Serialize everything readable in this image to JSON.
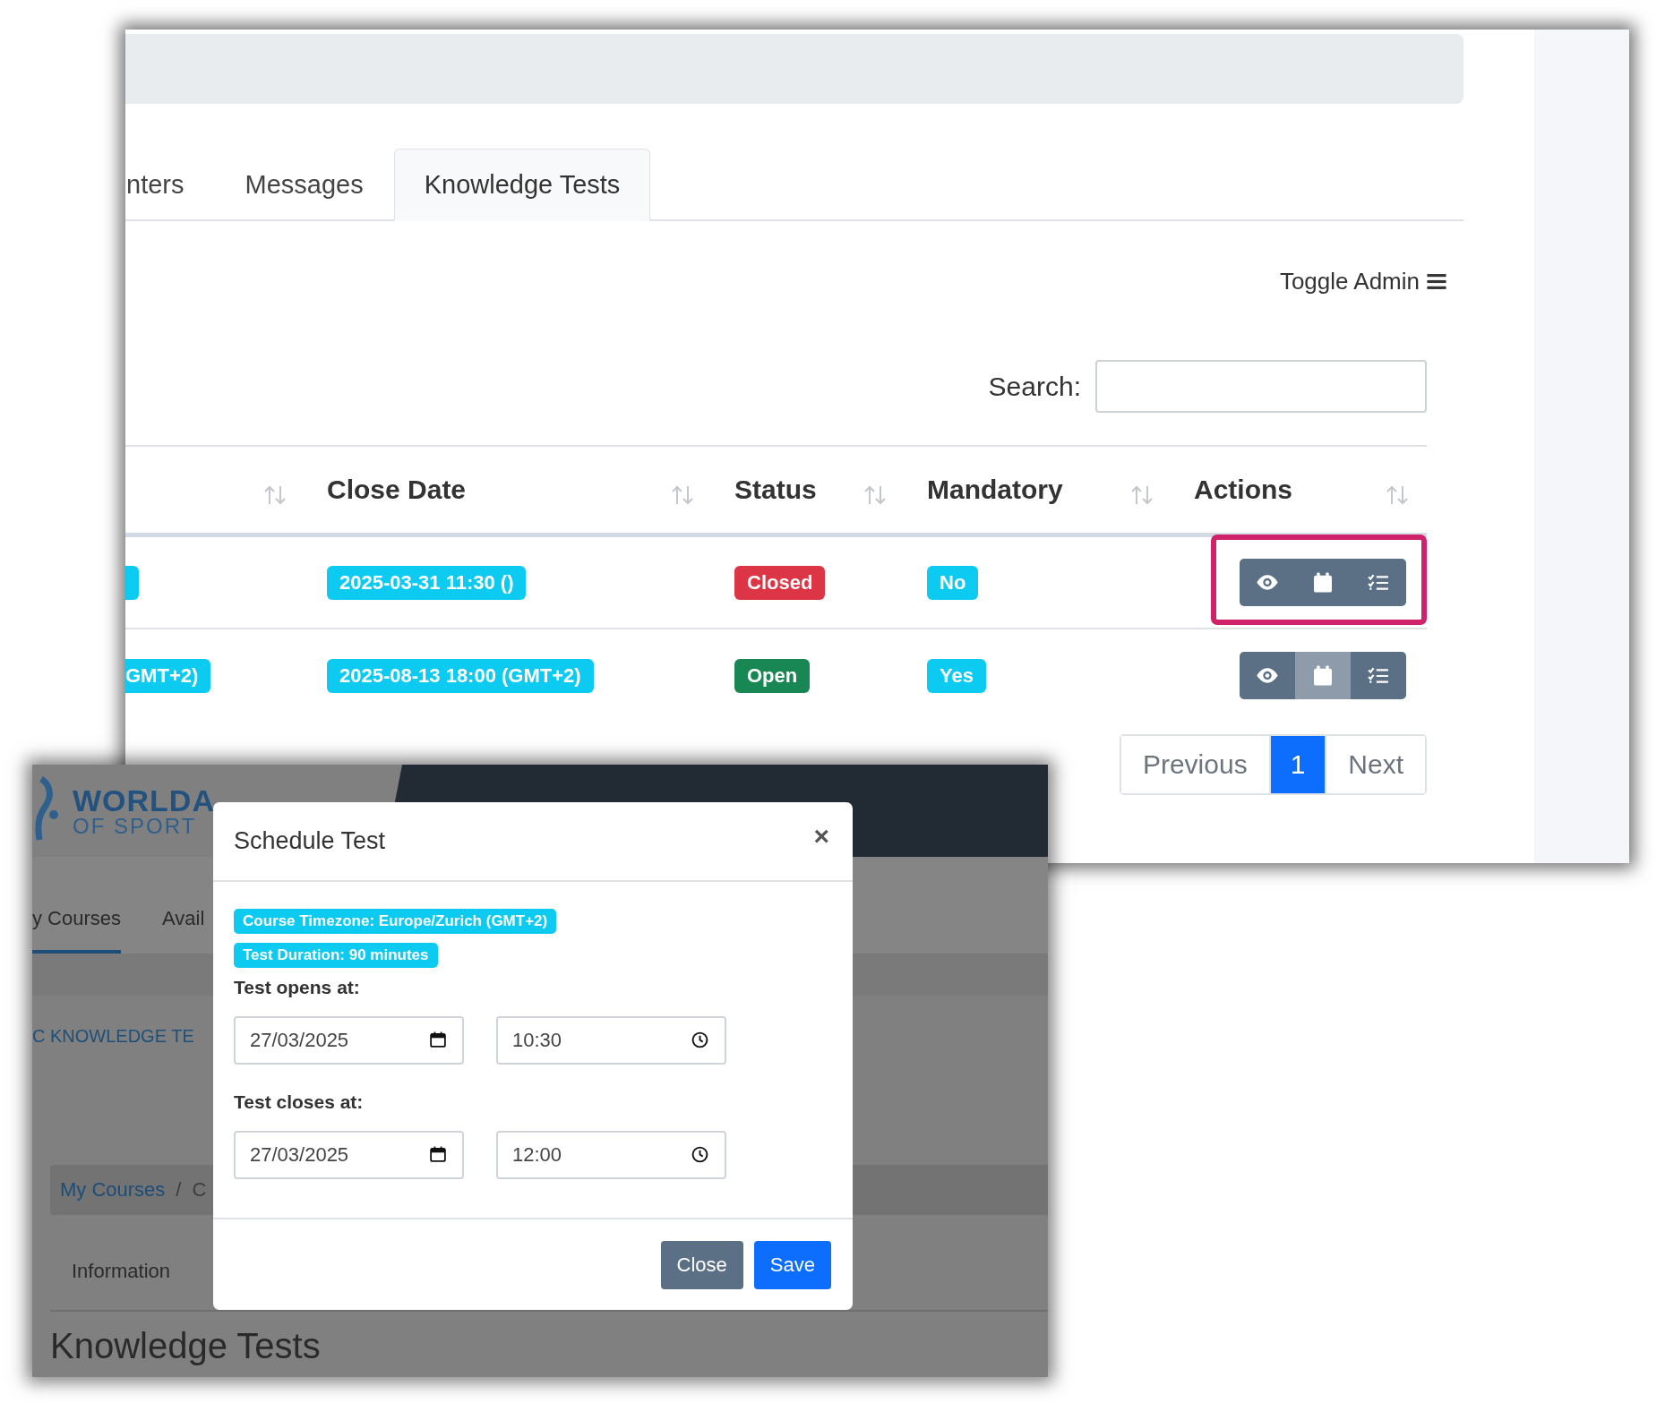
{
  "back_window": {
    "tabs": [
      {
        "label": "nters",
        "selected": false
      },
      {
        "label": "Messages",
        "selected": false
      },
      {
        "label": "Knowledge Tests",
        "selected": true
      }
    ],
    "toggle_admin": {
      "label": "Toggle Admin"
    },
    "search": {
      "label": "Search:"
    },
    "table": {
      "columns": [
        {
          "label": "Close Date"
        },
        {
          "label": "Status"
        },
        {
          "label": "Mandatory"
        },
        {
          "label": "Actions"
        }
      ],
      "rows": [
        {
          "highlighted": true,
          "column_1": null,
          "close_date": "2025-03-31 11:30 ()",
          "status": {
            "label": "Closed",
            "color": "#dc3545"
          },
          "mandatory": "No",
          "actions": [
            {
              "kind": "view",
              "hovered": false
            },
            {
              "kind": "schedule",
              "hovered": false
            },
            {
              "kind": "results",
              "hovered": false
            }
          ]
        },
        {
          "highlighted": false,
          "column_1": "GMT+2)",
          "close_date": "2025-08-13 18:00 (GMT+2)",
          "status": {
            "label": "Open",
            "color": "#198754"
          },
          "mandatory": "Yes",
          "actions": [
            {
              "kind": "view",
              "hovered": false
            },
            {
              "kind": "schedule",
              "hovered": true
            },
            {
              "kind": "results",
              "hovered": false
            }
          ]
        }
      ]
    },
    "pagination": [
      {
        "label": "Previous",
        "selected": false
      },
      {
        "label": "1",
        "selected": true
      },
      {
        "label": "Next",
        "selected": false
      }
    ]
  },
  "front_window": {
    "logo": {
      "line_1": "WORLDA",
      "line_2": "OF SPORT"
    },
    "nav": [
      {
        "label": "y Courses",
        "selected": true
      },
      {
        "label": "Avail",
        "selected": false
      }
    ],
    "course_title": "C KNOWLEDGE TE",
    "breadcrumb": {
      "items": [
        "My Courses",
        "C"
      ],
      "separator": "/"
    },
    "tabs": [
      {
        "label": "Information"
      }
    ],
    "heading": "Knowledge Tests"
  },
  "modal": {
    "title": "Schedule Test",
    "close": "×",
    "badges": [
      "Course Timezone: Europe/Zurich (GMT+2)",
      "Test Duration: 90 minutes"
    ],
    "fields": [
      {
        "label": "Test opens at:",
        "date": "27/03/2025",
        "time": "10:30"
      },
      {
        "label": "Test closes at:",
        "date": "27/03/2025",
        "time": "12:00"
      }
    ],
    "buttons": [
      {
        "label": "Close",
        "kind": "secondary"
      },
      {
        "label": "Save",
        "kind": "primary"
      }
    ]
  }
}
